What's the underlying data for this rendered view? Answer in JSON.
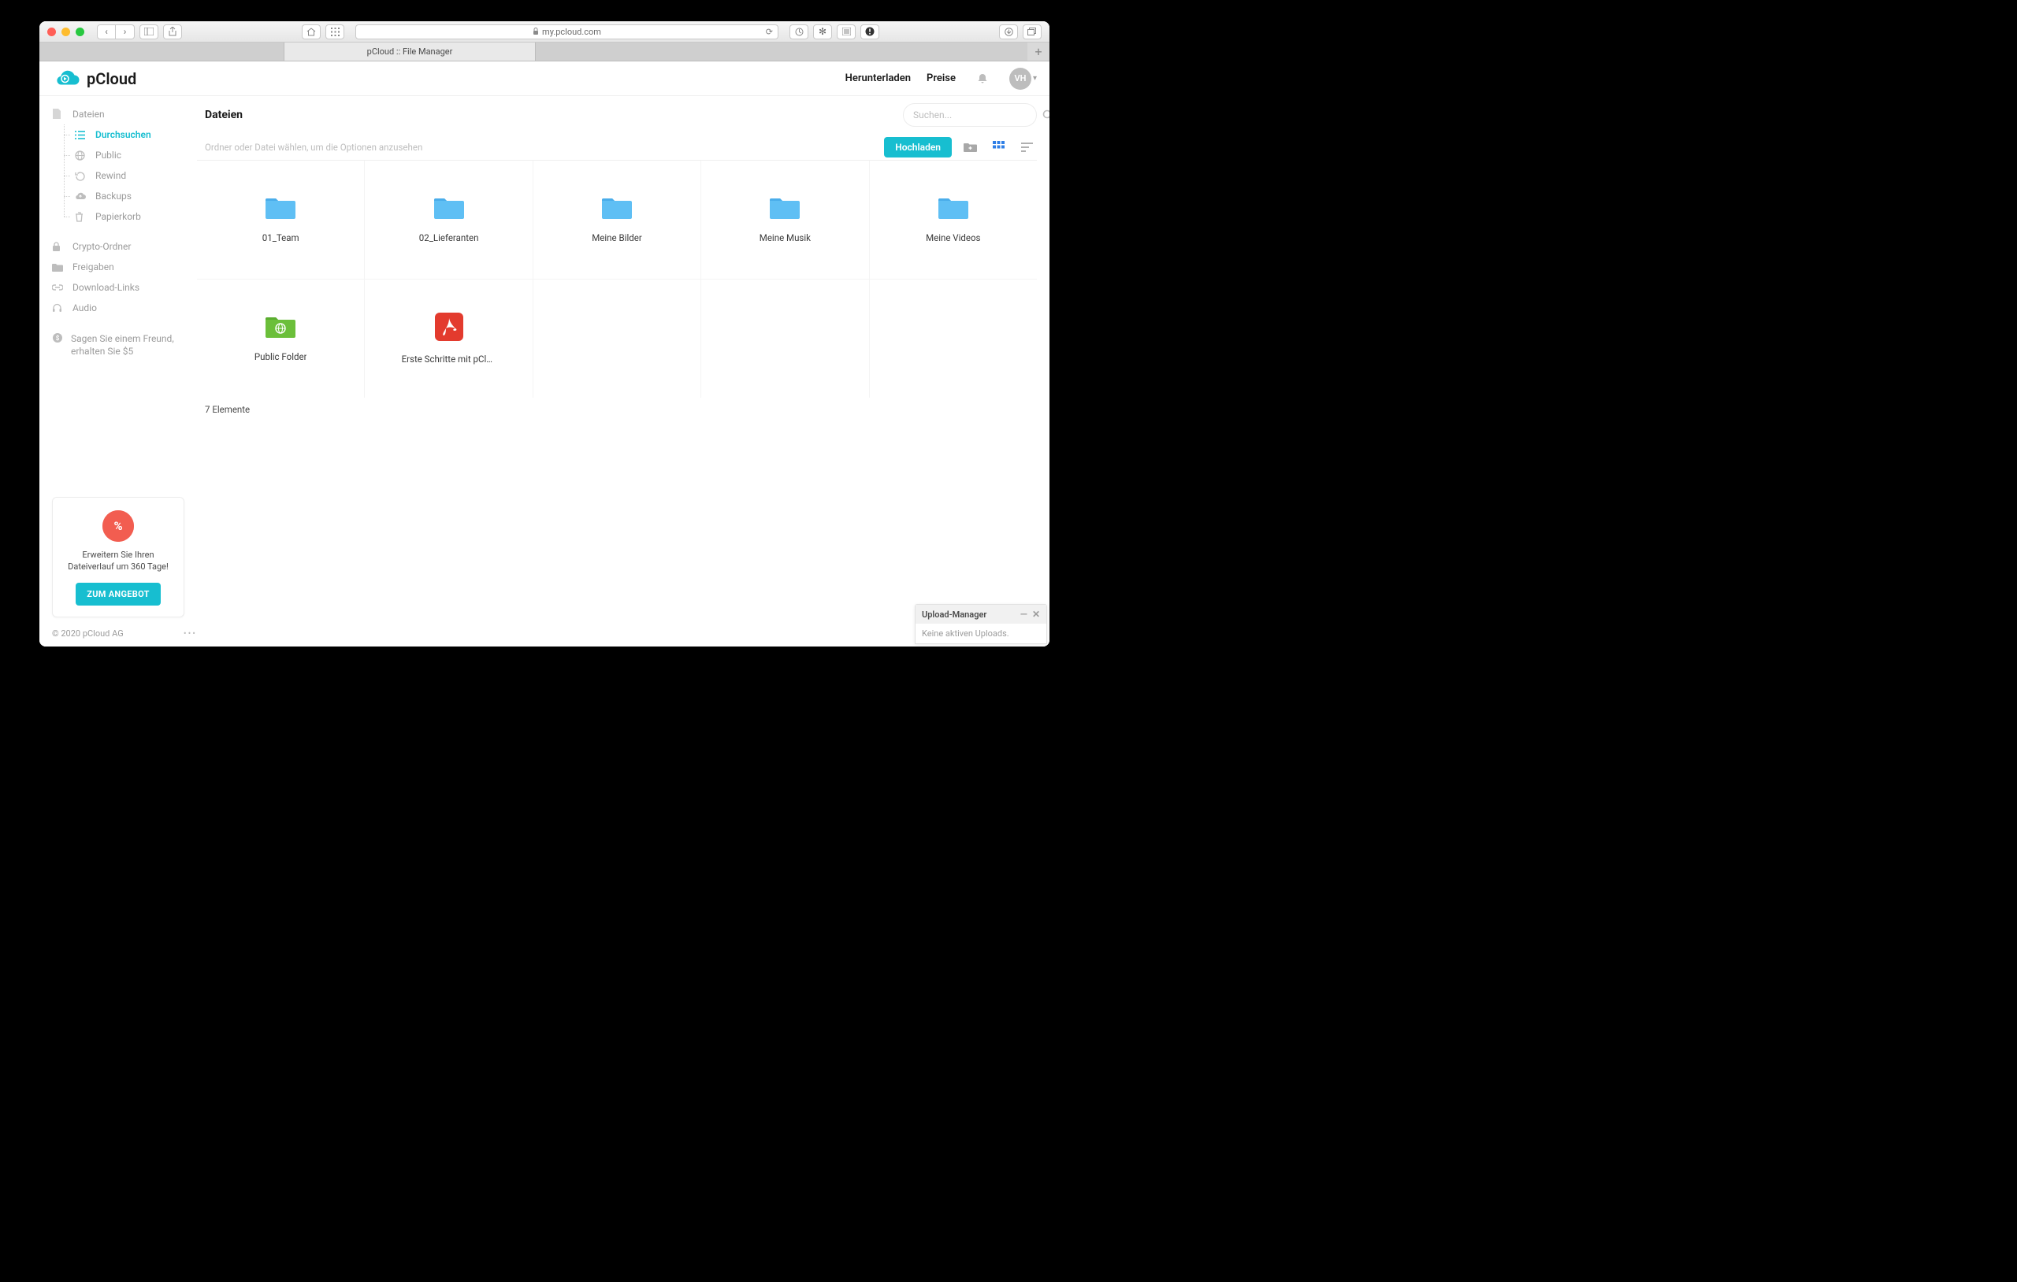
{
  "browser": {
    "url_host": "my.pcloud.com",
    "tab_title": "pCloud :: File Manager"
  },
  "header": {
    "brand": "pCloud",
    "nav_download": "Herunterladen",
    "nav_pricing": "Preise",
    "avatar_initials": "VH"
  },
  "sidebar": {
    "files_root": "Dateien",
    "browse": "Durchsuchen",
    "public": "Public",
    "rewind": "Rewind",
    "backups": "Backups",
    "trash": "Papierkorb",
    "crypto": "Crypto-Ordner",
    "shares": "Freigaben",
    "links": "Download-Links",
    "audio": "Audio",
    "referral": "Sagen Sie einem Freund, erhalten Sie $5"
  },
  "promo": {
    "badge": "%",
    "text": "Erweitern Sie Ihren Dateiverlauf um 360 Tage!",
    "cta": "ZUM ANGEBOT"
  },
  "footer": {
    "copyright": "© 2020 pCloud AG"
  },
  "main": {
    "title": "Dateien",
    "search_placeholder": "Suchen...",
    "toolbar_hint": "Ordner oder Datei wählen, um die Optionen anzusehen",
    "upload_label": "Hochladen",
    "item_count": "7 Elemente"
  },
  "folders": [
    {
      "name": "01_Team",
      "type": "folder"
    },
    {
      "name": "02_Lieferanten",
      "type": "folder"
    },
    {
      "name": "Meine Bilder",
      "type": "folder"
    },
    {
      "name": "Meine Musik",
      "type": "folder"
    },
    {
      "name": "Meine Videos",
      "type": "folder"
    },
    {
      "name": "Public Folder",
      "type": "public"
    },
    {
      "name": "Erste Schritte mit pClo...",
      "type": "pdf"
    }
  ],
  "upload_manager": {
    "title": "Upload-Manager",
    "status": "Keine aktiven Uploads."
  }
}
